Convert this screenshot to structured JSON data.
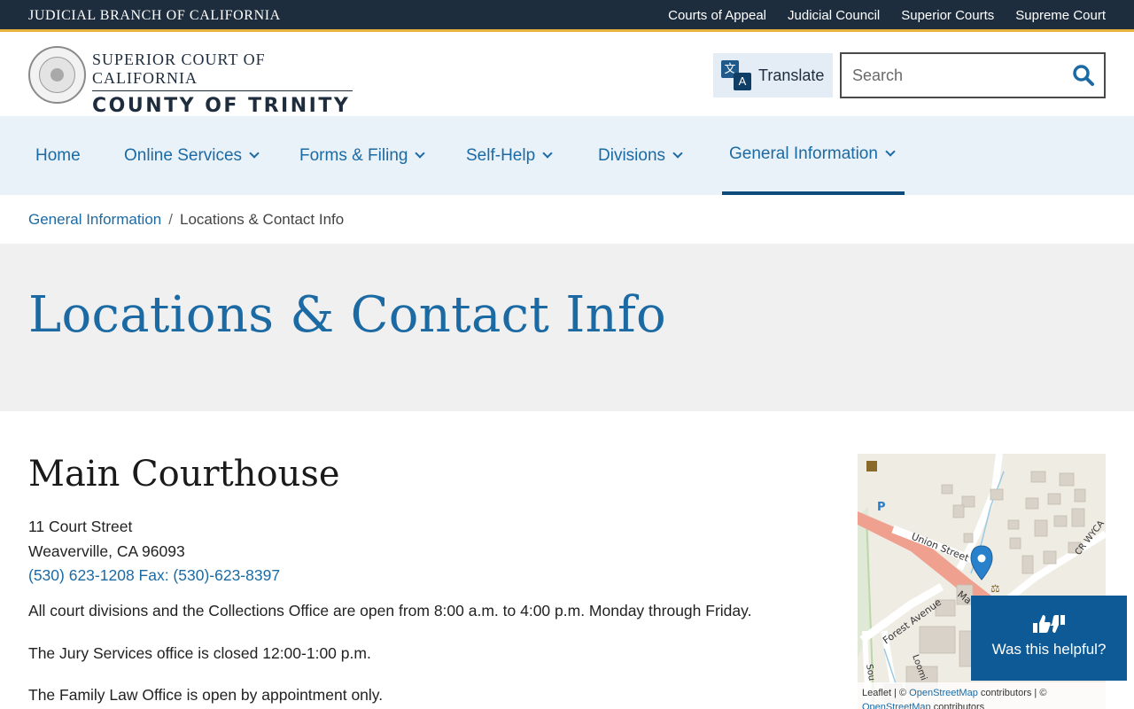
{
  "topbar": {
    "branch": "JUDICIAL BRANCH OF CALIFORNIA",
    "links": [
      "Courts of Appeal",
      "Judicial Council",
      "Superior Courts",
      "Supreme Court"
    ]
  },
  "header": {
    "court_line1": "SUPERIOR COURT OF CALIFORNIA",
    "court_line2": "COUNTY OF TRINITY",
    "translate_label": "Translate",
    "search_placeholder": "Search"
  },
  "nav": {
    "items": [
      {
        "label": "Home"
      },
      {
        "label": "Online Services"
      },
      {
        "label": "Forms & Filing"
      },
      {
        "label": "Self-Help"
      },
      {
        "label": "Divisions"
      },
      {
        "label": "General Information"
      }
    ]
  },
  "breadcrumb": {
    "parent": "General Information",
    "separator": "/",
    "current": "Locations & Contact Info"
  },
  "page": {
    "title": "Locations & Contact Info"
  },
  "location": {
    "name": "Main Courthouse",
    "street": "11 Court Street",
    "city": "Weaverville, CA 96093",
    "phone": "(530) 623-1208 Fax: (530)-623-8397",
    "hours": "All court divisions and the Collections Office are open from 8:00 a.m. to 4:00 p.m. Monday through Friday.",
    "jury": "The Jury Services office is closed 12:00-1:00 p.m.",
    "family": "The Family Law Office is open by appointment only."
  },
  "map": {
    "streets": [
      "Union Street",
      "Forest Avenue",
      "CR WYCA",
      "Ma",
      "Loomi",
      "Sou"
    ],
    "attribution_prefix": "Leaflet | © ",
    "attribution_link1": "OpenStreetMap",
    "attribution_mid": " contributors | ©",
    "attribution_link2": "OpenStreetMap",
    "attribution_suffix": " contributors"
  },
  "helpful": {
    "label": "Was this helpful?"
  },
  "colors": {
    "topbar": "#1e2d3d",
    "accent": "#e8b33d",
    "link": "#1c6aa3",
    "nav_bg": "#e9f1f9",
    "helpful_bg": "#0d5a96"
  }
}
